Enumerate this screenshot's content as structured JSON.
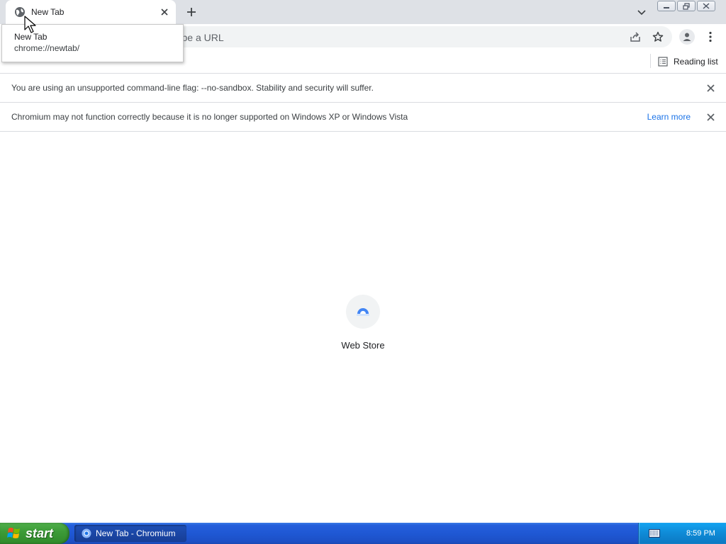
{
  "browser": {
    "tab": {
      "title": "New Tab",
      "favicon": "globe-icon"
    },
    "new_tab_icon": "plus-icon",
    "tab_search_icon": "chevron-down-icon",
    "omnibox": {
      "placeholder": "Search Google or type a URL",
      "visible_text": "h or type a URL"
    },
    "reading_list_label": "Reading list"
  },
  "hovercard": {
    "title": "New Tab",
    "url": "chrome://newtab/"
  },
  "infobars": [
    {
      "message": "You are using an unsupported command-line flag: --no-sandbox. Stability and security will suffer."
    },
    {
      "message": "Chromium may not function correctly because it is no longer supported on Windows XP or Windows Vista",
      "link": "Learn more"
    }
  ],
  "content": {
    "shortcut": {
      "label": "Web Store",
      "icon": "web-store-icon"
    }
  },
  "taskbar": {
    "start_label": "start",
    "task_label": "New Tab - Chromium",
    "clock": "8:59 PM"
  },
  "colors": {
    "accent": "#1a73e8",
    "taskbar": "#245edb",
    "start": "#3d9c38",
    "tray": "#0f8ad6"
  }
}
